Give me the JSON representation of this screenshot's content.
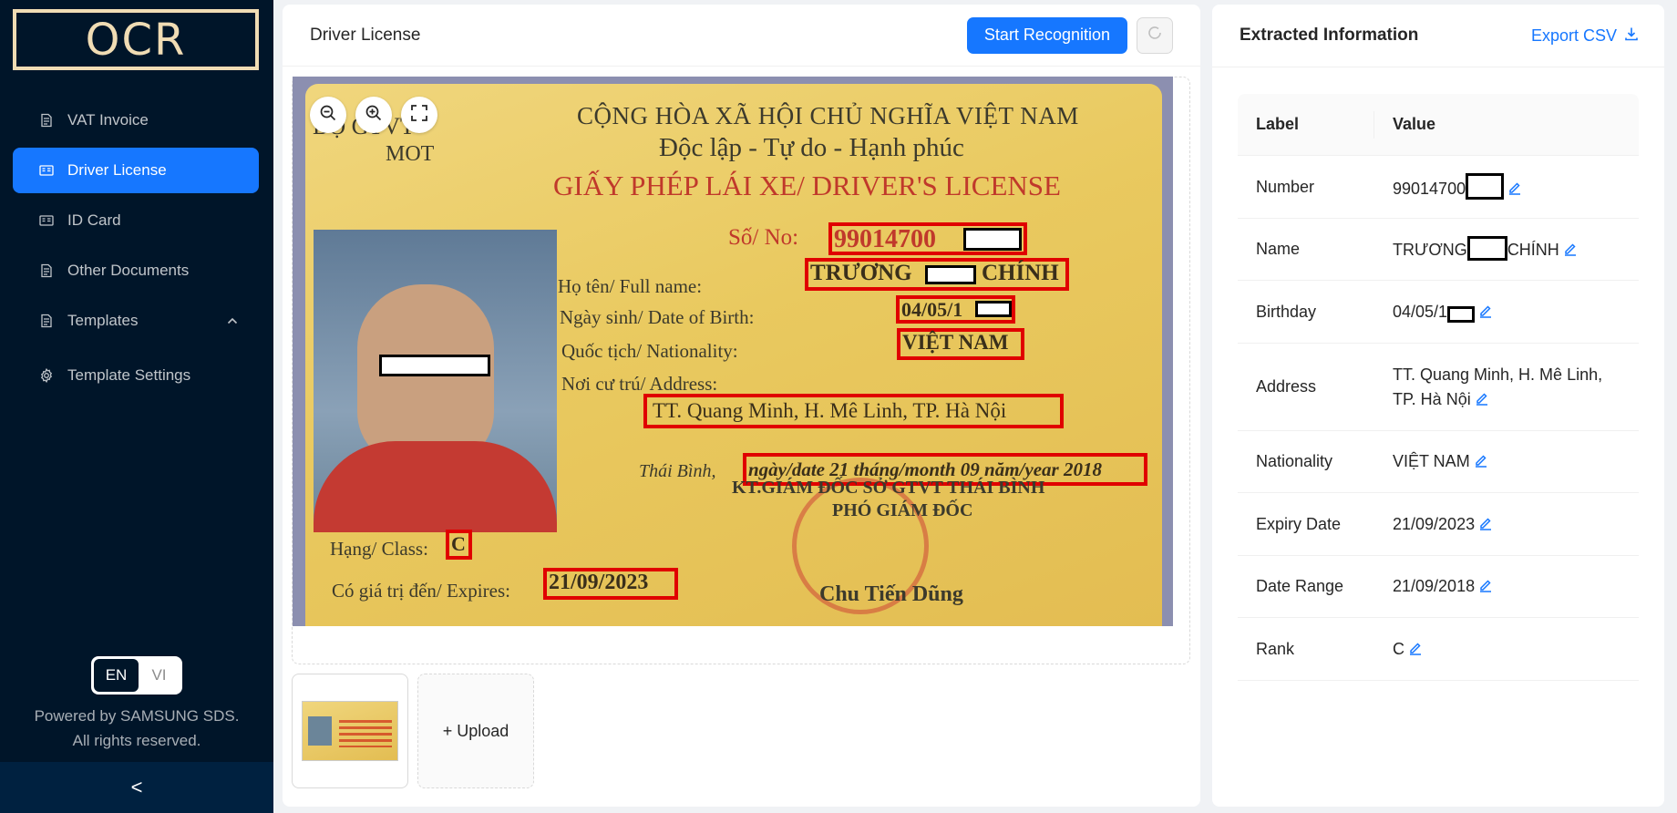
{
  "app": {
    "logo": "OCR"
  },
  "sidebar": {
    "items": [
      {
        "label": "VAT Invoice",
        "icon": "file-icon"
      },
      {
        "label": "Driver License",
        "icon": "id-card-icon",
        "active": true
      },
      {
        "label": "ID Card",
        "icon": "id-card-icon"
      },
      {
        "label": "Other Documents",
        "icon": "file-icon"
      },
      {
        "label": "Templates",
        "icon": "file-icon",
        "expanded": true
      },
      {
        "label": "Template Settings",
        "icon": "gear-icon"
      }
    ],
    "lang": {
      "en": "EN",
      "vi": "VI",
      "selected": "EN"
    },
    "powered_line1": "Powered by SAMSUNG SDS.",
    "powered_line2": "All rights reserved.",
    "collapse": "<"
  },
  "main": {
    "title": "Driver License",
    "start_button": "Start Recognition",
    "upload_label": "+ Upload"
  },
  "license_card": {
    "authority_1": "BỘ GTVT",
    "authority_2": "MOT",
    "nation": "CỘNG HÒA XÃ HỘI CHỦ NGHĨA VIỆT NAM",
    "motto": "Độc lập - Tự do - Hạnh phúc",
    "doc_title": "GIẤY PHÉP LÁI XE/ DRIVER'S LICENSE",
    "no_label": "Số/ No:",
    "no_value": "99014700",
    "name_label": "Họ tên/ Full name:",
    "name_value_a": "TRƯƠNG",
    "name_value_b": "CHÍNH",
    "dob_label": "Ngày sinh/ Date of Birth:",
    "dob_value": "04/05/1",
    "nat_label": "Quốc tịch/ Nationality:",
    "nat_value": "VIỆT NAM",
    "addr_label": "Nơi cư trú/ Address:",
    "addr_value": "TT. Quang Minh, H. Mê Linh, TP. Hà Nội",
    "issue_place": "Thái Bình,",
    "issue_value": "ngày/date 21 tháng/month 09 năm/year 2018",
    "issuer_1": "KT.GIÁM ĐỐC SỞ GTVT THÁI BÌNH",
    "issuer_2": "PHÓ GIÁM ĐỐC",
    "class_label": "Hạng/ Class:",
    "class_value": "C",
    "expires_label": "Có giá trị đến/ Expires:",
    "expires_value": "21/09/2023",
    "signer": "Chu Tiến Dũng"
  },
  "extracted": {
    "title": "Extracted Information",
    "export_label": "Export CSV",
    "col_label": "Label",
    "col_value": "Value",
    "rows": [
      {
        "label": "Number",
        "value": "99014700"
      },
      {
        "label": "Name",
        "value": "TRƯƠNG",
        "value_b": "CHÍNH"
      },
      {
        "label": "Birthday",
        "value": "04/05/1"
      },
      {
        "label": "Address",
        "value": "TT. Quang Minh, H. Mê Linh, TP. Hà Nội"
      },
      {
        "label": "Nationality",
        "value": "VIỆT NAM"
      },
      {
        "label": "Expiry Date",
        "value": "21/09/2023"
      },
      {
        "label": "Date Range",
        "value": "21/09/2018"
      },
      {
        "label": "Rank",
        "value": "C"
      }
    ]
  },
  "colors": {
    "primary": "#1677ff",
    "sidebar": "#001529",
    "logo": "#f0dcb4",
    "box": "#e00000"
  }
}
